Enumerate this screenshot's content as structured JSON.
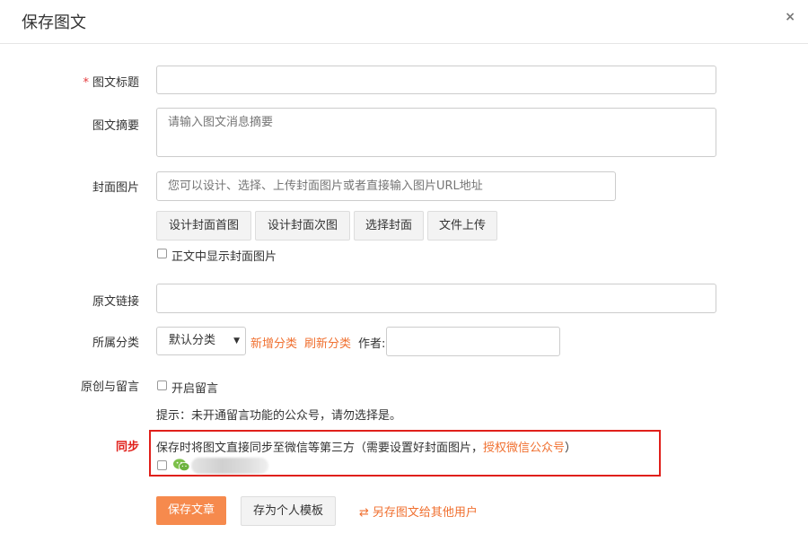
{
  "modal": {
    "title": "保存图文",
    "close": "×"
  },
  "form": {
    "title_label": "图文标题",
    "required_mark": "*",
    "summary_label": "图文摘要",
    "summary_placeholder": "请输入图文消息摘要",
    "cover_label": "封面图片",
    "cover_placeholder": "您可以设计、选择、上传封面图片或者直接输入图片URL地址",
    "cover_buttons": [
      "设计封面首图",
      "设计封面次图",
      "选择封面",
      "文件上传"
    ],
    "show_cover_label": "正文中显示封面图片",
    "source_link_label": "原文链接",
    "category_label": "所属分类",
    "category_selected": "默认分类",
    "add_category": "新增分类",
    "refresh_category": "刷新分类",
    "author_label": "作者:",
    "original_label": "原创与留言",
    "enable_comment_label": "开启留言",
    "hint": "提示：未开通留言功能的公众号，请勿选择是。",
    "sync_label": "同步",
    "sync_text": "保存时将图文直接同步至微信等第三方（需要设置好封面图片，",
    "sync_link": "授权微信公众号",
    "sync_text_end": "）",
    "wechat_icon": "wechat-icon"
  },
  "footer": {
    "save_article": "保存文章",
    "save_template": "存为个人模板",
    "save_for_others_icon": "⇄",
    "save_for_others": "另存图文给其他用户"
  },
  "colors": {
    "accent": "#f68a4d",
    "link": "#f07030",
    "highlight": "#e0201b"
  }
}
